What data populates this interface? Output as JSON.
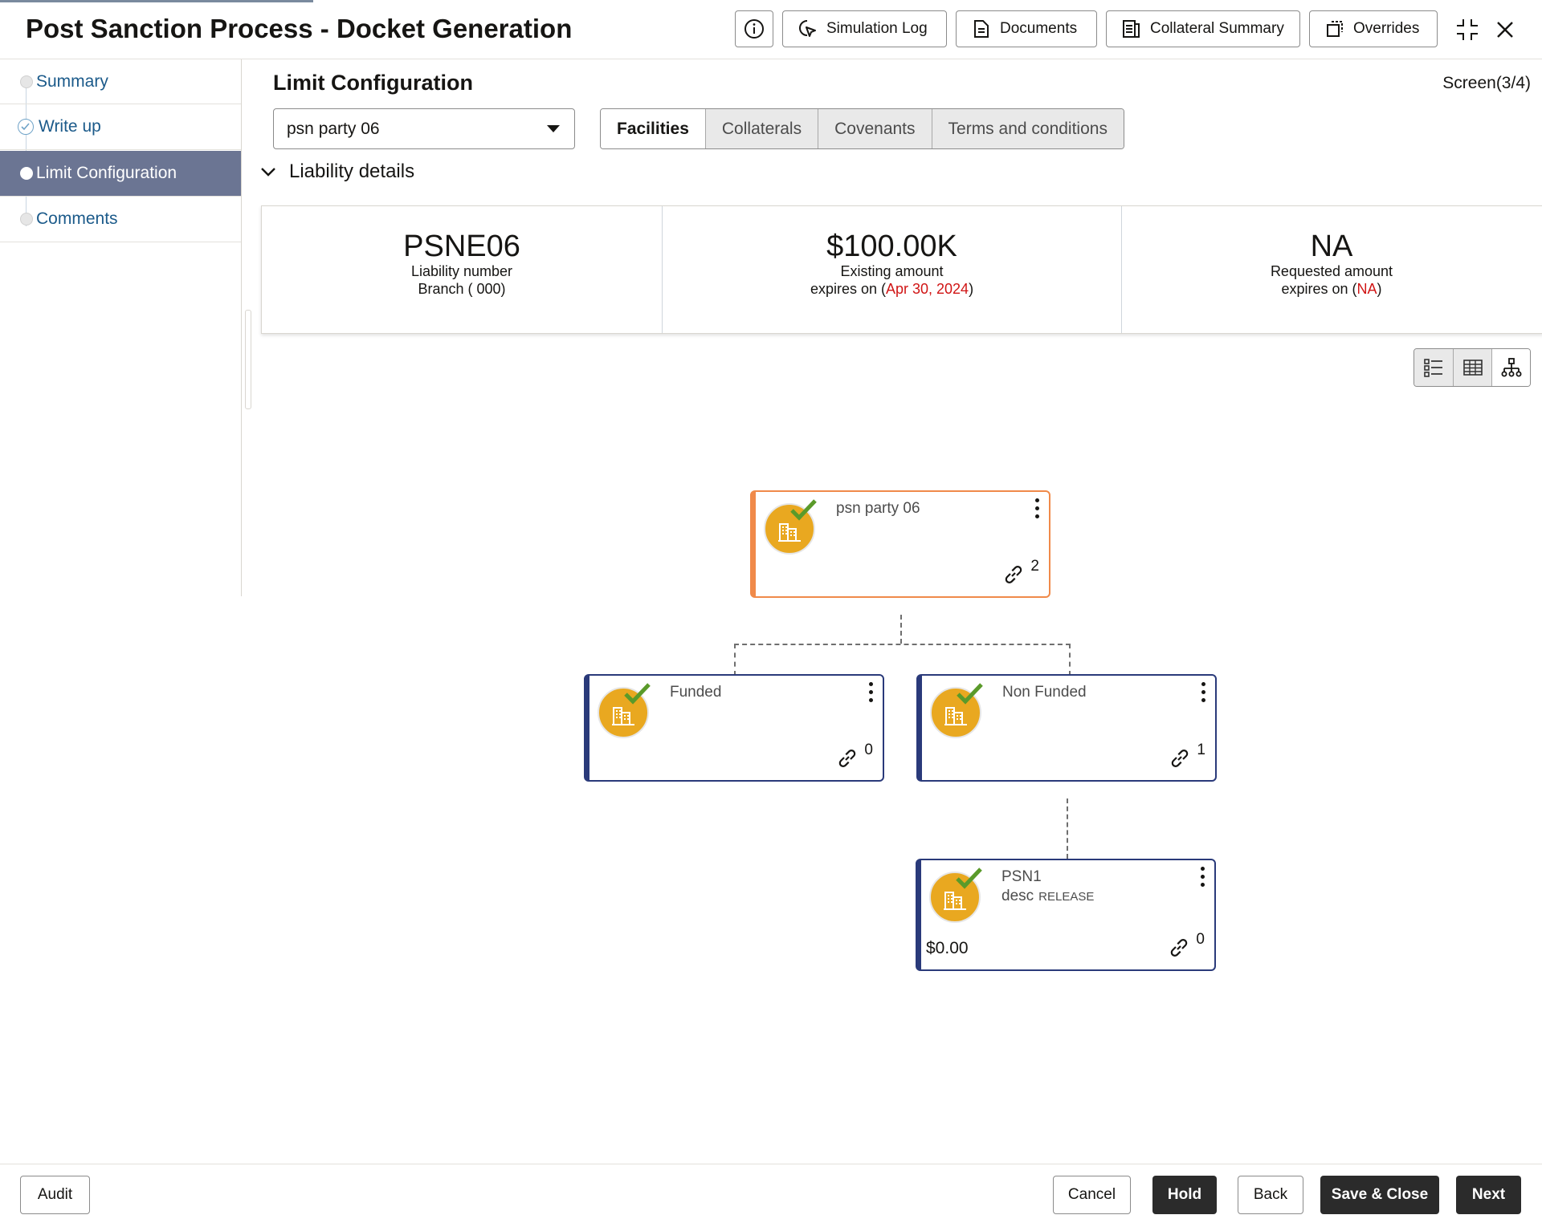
{
  "header": {
    "title": "Post Sanction Process - Docket Generation",
    "buttons": {
      "simulation_log": "Simulation Log",
      "documents": "Documents",
      "collateral_summary": "Collateral Summary",
      "overrides": "Overrides"
    }
  },
  "sidebar": {
    "items": [
      {
        "label": "Summary",
        "state": "pending"
      },
      {
        "label": "Write up",
        "state": "done"
      },
      {
        "label": "Limit Configuration",
        "state": "active"
      },
      {
        "label": "Comments",
        "state": "pending"
      }
    ]
  },
  "main": {
    "title": "Limit Configuration",
    "screen_indicator": "Screen(3/4)",
    "party_select": "psn party 06",
    "tabs": [
      "Facilities",
      "Collaterals",
      "Covenants",
      "Terms and conditions"
    ],
    "active_tab": "Facilities",
    "liability_section": "Liability details",
    "cards": [
      {
        "value": "PSNE06",
        "line1": "Liability number",
        "line2": "Branch ( 000)"
      },
      {
        "value": "$100.00K",
        "line1": "Existing amount",
        "line2_prefix": "expires on (",
        "line2_value": "Apr 30, 2024",
        "line2_suffix": ")"
      },
      {
        "value": "NA",
        "line1": "Requested amount",
        "line2_prefix": "expires on (",
        "line2_value": "NA",
        "line2_suffix": ")"
      }
    ],
    "view_modes": [
      "list-view-icon",
      "table-view-icon",
      "tree-view-icon"
    ],
    "active_view": "tree-view-icon"
  },
  "tree": {
    "root": {
      "name": "psn party 06",
      "links": "2"
    },
    "funded": {
      "name": "Funded",
      "links": "0"
    },
    "non_funded": {
      "name": "Non Funded",
      "links": "1"
    },
    "facility": {
      "name": "PSN1",
      "desc": "desc",
      "status": "RELEASE",
      "amount": "$0.00",
      "links": "0"
    }
  },
  "footer": {
    "audit": "Audit",
    "cancel": "Cancel",
    "hold": "Hold",
    "back": "Back",
    "save_close": "Save & Close",
    "next": "Next"
  },
  "colors": {
    "root_border": "#f08a4a",
    "node_border": "#2a3a7a",
    "avatar": "#e9a820",
    "check": "#5a9a2a",
    "active_sidebar": "#6b7593",
    "expiry_date": "#d01414"
  }
}
